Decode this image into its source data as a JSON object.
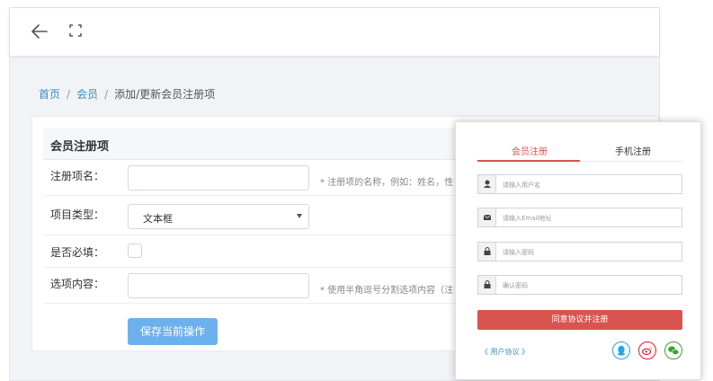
{
  "breadcrumb": {
    "home": "首页",
    "members": "会员",
    "current": "添加/更新会员注册项",
    "separator": "/"
  },
  "card": {
    "title": "会员注册项",
    "fields": {
      "name_label": "注册项名：",
      "name_hint": "* 注册项的名称，例如：姓名，性",
      "type_label": "项目类型：",
      "type_value": "文本框",
      "required_label": "是否必填：",
      "options_label": "选项内容：",
      "options_hint": "* 使用半角逗号分割选项内容（注"
    },
    "save_label": "保存当前操作"
  },
  "popup": {
    "tab_member": "会员注册",
    "tab_phone": "手机注册",
    "username_placeholder": "请输入用户名",
    "email_placeholder": "请输入Email地址",
    "password_placeholder": "请输入密码",
    "confirm_placeholder": "确认密码",
    "submit_label": "同意协议并注册",
    "agreement_label": "《 用户协议 》"
  },
  "colors": {
    "accent_blue": "#6cb0ed",
    "link_blue": "#3c8dbc",
    "register_red": "#d9534f",
    "qq": "#1ea7e1",
    "weibo": "#e6162d",
    "wechat": "#3aa335"
  },
  "icons": {
    "back": "arrow-left-icon",
    "fullscreen": "fullscreen-icon",
    "user": "user-icon",
    "email": "envelope-icon",
    "lock": "lock-icon",
    "qq": "qq-icon",
    "weibo": "weibo-icon",
    "wechat": "wechat-icon"
  }
}
